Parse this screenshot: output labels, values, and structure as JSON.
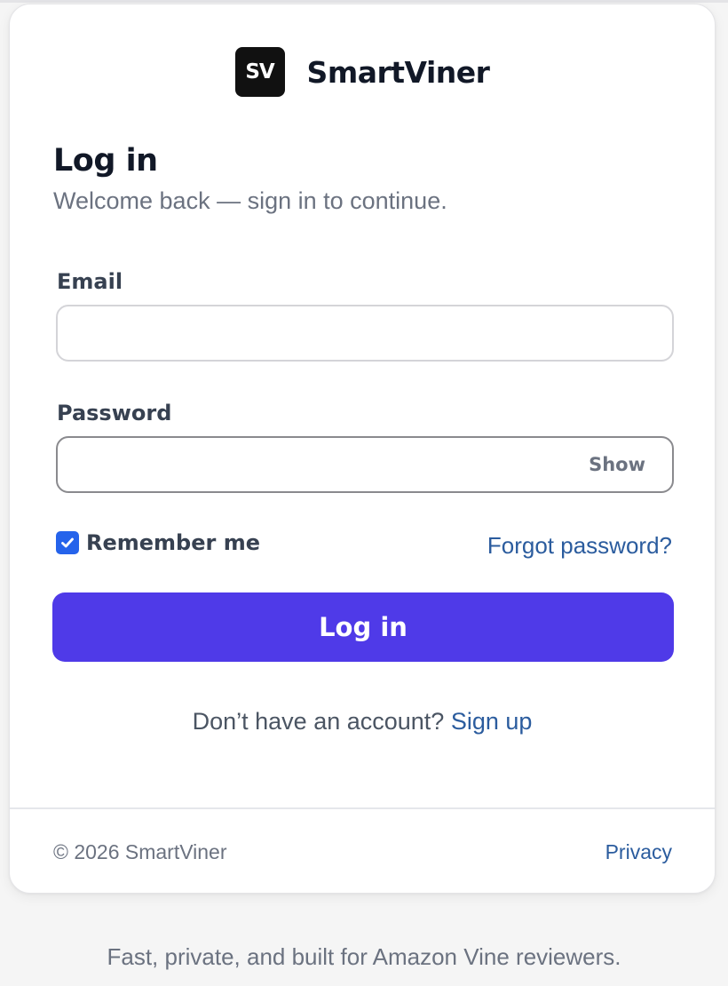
{
  "brand": {
    "logo_text": "SV",
    "name": "SmartViner"
  },
  "form": {
    "title": "Log in",
    "subtitle": "Welcome back — sign in to continue.",
    "email": {
      "label": "Email",
      "value": "",
      "placeholder": ""
    },
    "password": {
      "label": "Password",
      "value": "",
      "placeholder": "",
      "show_label": "Show"
    },
    "remember": {
      "label": "Remember me",
      "checked": true
    },
    "forgot_label": "Forgot password?",
    "submit_label": "Log in",
    "signup_prompt": "Don’t have an account?",
    "signup_label": "Sign up"
  },
  "footer": {
    "copyright": "© 2026 SmartViner",
    "privacy_label": "Privacy"
  },
  "tagline": "Fast, private, and built for Amazon Vine reviewers.",
  "colors": {
    "primary_button": "#4f3ae8",
    "link": "#2b5c9e",
    "checkbox": "#2563eb"
  },
  "icons": {
    "checkbox": "checkmark-icon"
  }
}
